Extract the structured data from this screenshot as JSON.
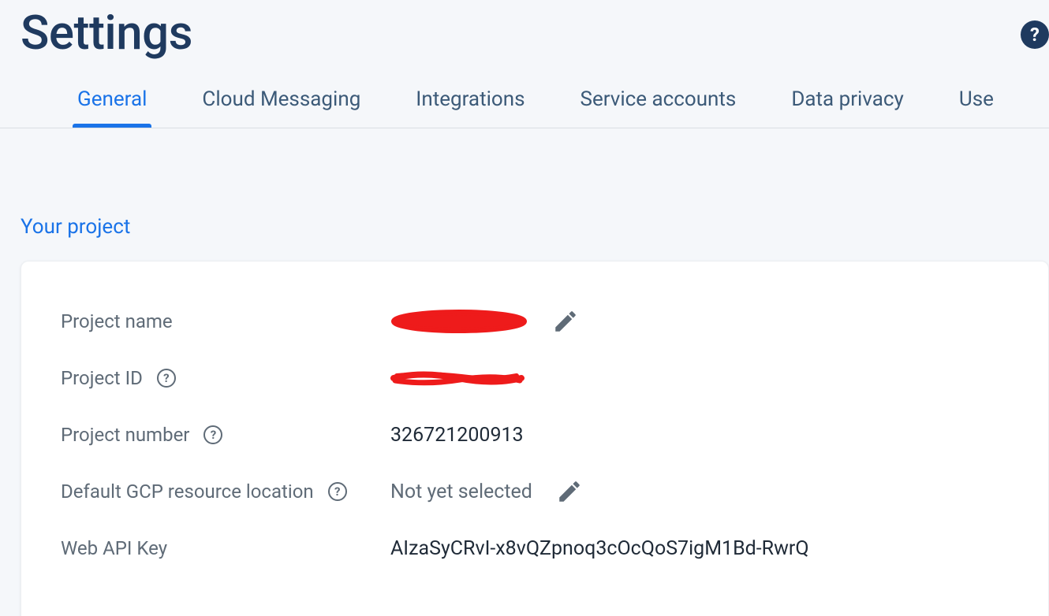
{
  "header": {
    "title": "Settings"
  },
  "tabs": {
    "active_index": 0,
    "items": [
      {
        "label": "General"
      },
      {
        "label": "Cloud Messaging"
      },
      {
        "label": "Integrations"
      },
      {
        "label": "Service accounts"
      },
      {
        "label": "Data privacy"
      },
      {
        "label": "Use"
      }
    ]
  },
  "section": {
    "heading": "Your project"
  },
  "project": {
    "name_label": "Project name",
    "name_value_redacted": true,
    "id_label": "Project ID",
    "id_value_redacted": true,
    "number_label": "Project number",
    "number_value": "326721200913",
    "gcp_location_label": "Default GCP resource location",
    "gcp_location_value": "Not yet selected",
    "web_api_key_label": "Web API Key",
    "web_api_key_value": "AIzaSyCRvI-x8vQZpnoq3cOcQoS7igM1Bd-RwrQ"
  },
  "icons": {
    "help_glyph": "?",
    "info_glyph": "?"
  }
}
